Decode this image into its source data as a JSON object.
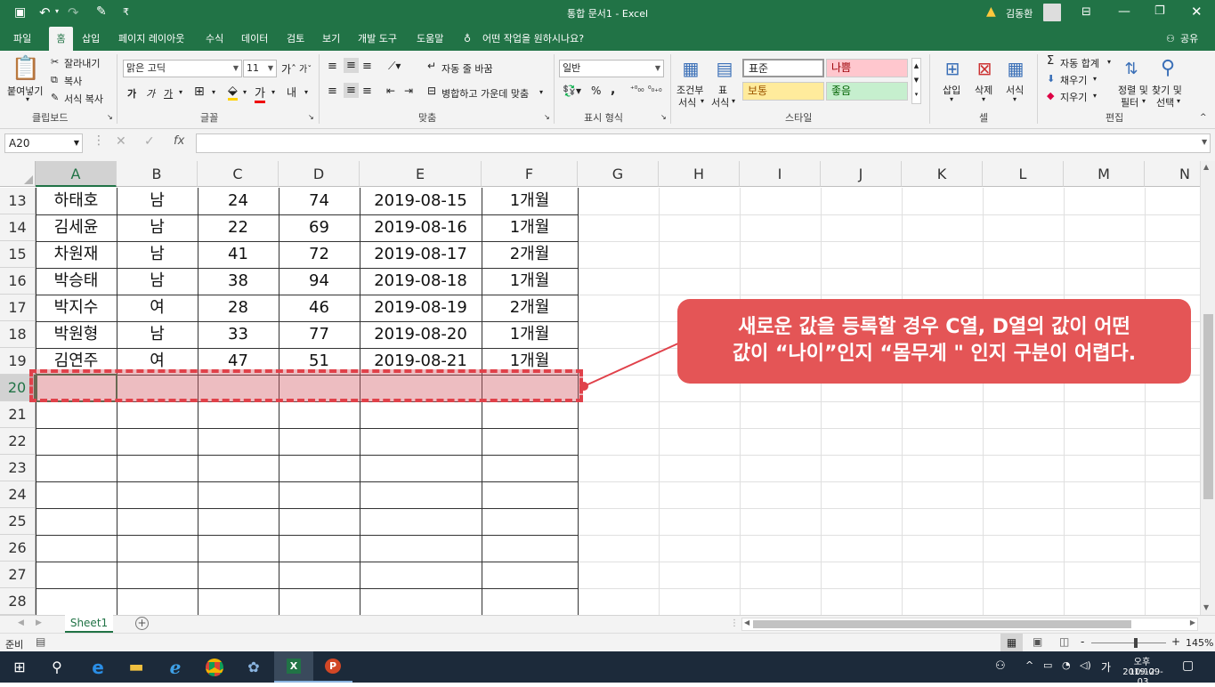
{
  "titlebar": {
    "title": "통합 문서1  -  Excel",
    "user": "김동환",
    "qat_more": "₹"
  },
  "tabs": [
    "파일",
    "홈",
    "삽입",
    "페이지 레이아웃",
    "수식",
    "데이터",
    "검토",
    "보기",
    "개발 도구",
    "도움말"
  ],
  "tellme": "어떤 작업을 원하시나요?",
  "share": "공유",
  "ribbon": {
    "clipboard": {
      "paste": "붙여넣기",
      "cut": "잘라내기",
      "copy": "복사",
      "format_painter": "서식 복사",
      "label": "클립보드"
    },
    "font": {
      "name": "맑은 고딕",
      "size": "11",
      "bold": "가",
      "italic": "가",
      "underline": "가",
      "label": "글꼴"
    },
    "align": {
      "wrap": "자동 줄 바꿈",
      "merge": "병합하고 가운데 맞춤",
      "label": "맞춤"
    },
    "number": {
      "format": "일반",
      "label": "표시 형식",
      "percent": "%",
      "comma": ","
    },
    "styles": {
      "cond1": "조건부",
      "cond2": "서식",
      "table1": "표",
      "table2": "서식",
      "normal": "표준",
      "bad": "나쁨",
      "neutral": "보통",
      "good": "좋음",
      "label": "스타일"
    },
    "cells": {
      "insert": "삽입",
      "delete": "삭제",
      "format": "서식",
      "label": "셀"
    },
    "editing": {
      "autosum": "자동 합계",
      "fill": "채우기",
      "clear": "지우기",
      "sort1": "정렬 및",
      "sort2": "필터",
      "find1": "찾기 및",
      "find2": "선택",
      "label": "편집"
    }
  },
  "formula": {
    "namebox": "A20",
    "value": ""
  },
  "columns": [
    "A",
    "B",
    "C",
    "D",
    "E",
    "F",
    "G",
    "H",
    "I",
    "J",
    "K",
    "L",
    "M",
    "N"
  ],
  "rows": [
    {
      "num": "13",
      "cells": [
        "하태호",
        "남",
        "24",
        "74",
        "2019-08-15",
        "1개월"
      ]
    },
    {
      "num": "14",
      "cells": [
        "김세윤",
        "남",
        "22",
        "69",
        "2019-08-16",
        "1개월"
      ]
    },
    {
      "num": "15",
      "cells": [
        "차원재",
        "남",
        "41",
        "72",
        "2019-08-17",
        "2개월"
      ]
    },
    {
      "num": "16",
      "cells": [
        "박승태",
        "남",
        "38",
        "94",
        "2019-08-18",
        "1개월"
      ]
    },
    {
      "num": "17",
      "cells": [
        "박지수",
        "여",
        "28",
        "46",
        "2019-08-19",
        "2개월"
      ]
    },
    {
      "num": "18",
      "cells": [
        "박원형",
        "남",
        "33",
        "77",
        "2019-08-20",
        "1개월"
      ]
    },
    {
      "num": "19",
      "cells": [
        "김연주",
        "여",
        "47",
        "51",
        "2019-08-21",
        "1개월"
      ]
    },
    {
      "num": "20",
      "cells": [
        "",
        "",
        "",
        "",
        "",
        ""
      ]
    },
    {
      "num": "21",
      "cells": [
        "",
        "",
        "",
        "",
        "",
        ""
      ]
    },
    {
      "num": "22",
      "cells": [
        "",
        "",
        "",
        "",
        "",
        ""
      ]
    },
    {
      "num": "23",
      "cells": [
        "",
        "",
        "",
        "",
        "",
        ""
      ]
    },
    {
      "num": "24",
      "cells": [
        "",
        "",
        "",
        "",
        "",
        ""
      ]
    },
    {
      "num": "25",
      "cells": [
        "",
        "",
        "",
        "",
        "",
        ""
      ]
    },
    {
      "num": "26",
      "cells": [
        "",
        "",
        "",
        "",
        "",
        ""
      ]
    },
    {
      "num": "27",
      "cells": [
        "",
        "",
        "",
        "",
        "",
        ""
      ]
    },
    {
      "num": "28",
      "cells": [
        "",
        "",
        "",
        "",
        "",
        ""
      ]
    }
  ],
  "callout": {
    "line1": "새로운 값을 등록할 경우 C열, D열의 값이 어떤",
    "line2": "값이 “나이”인지 “몸무게 \" 인지 구분이 어렵다."
  },
  "sheet": {
    "tab": "Sheet1",
    "add": "+"
  },
  "status": {
    "ready": "준비",
    "zoom": "145%",
    "zoom_minus": "-",
    "zoom_plus": "+"
  },
  "taskbar": {
    "time": "오후 10:12",
    "date": "2019-09-03",
    "ime": "가"
  },
  "colors": {
    "excel_green": "#217346",
    "callout": "#e45556",
    "selection": "#e0414a"
  }
}
